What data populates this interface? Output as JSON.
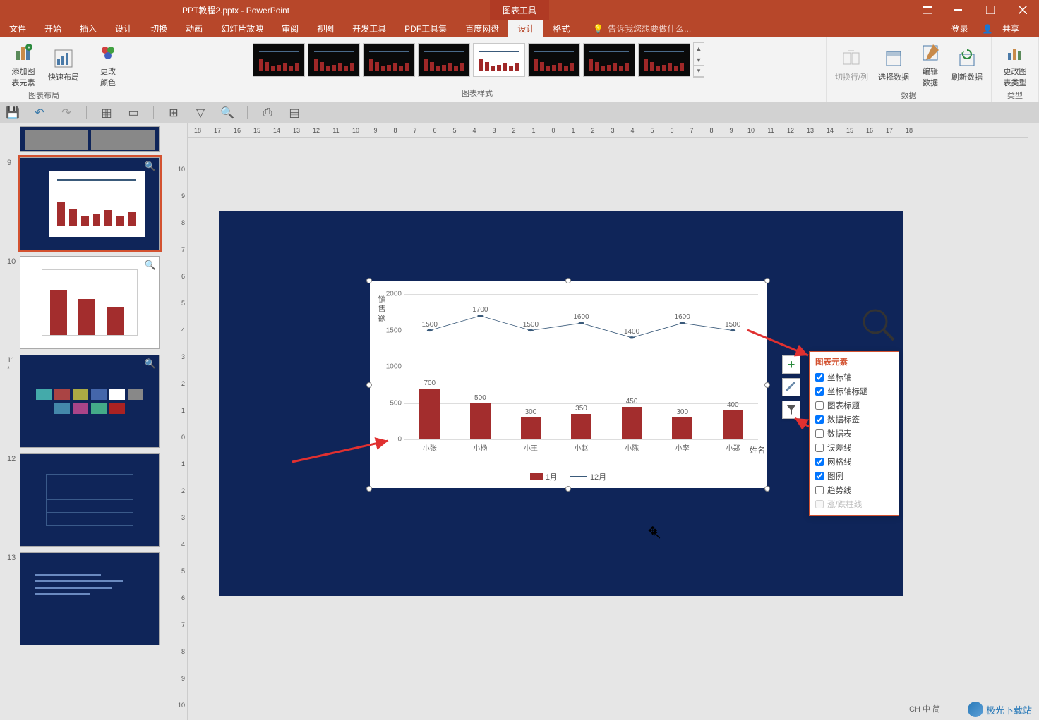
{
  "window": {
    "title": "PPT教程2.pptx - PowerPoint",
    "tools_tab": "图表工具",
    "login": "登录",
    "share": "共享"
  },
  "menu": {
    "tabs": [
      "文件",
      "开始",
      "插入",
      "设计",
      "切换",
      "动画",
      "幻灯片放映",
      "审阅",
      "视图",
      "开发工具",
      "PDF工具集",
      "百度网盘",
      "设计",
      "格式"
    ],
    "active_index": 12,
    "tell_me": "告诉我您想要做什么..."
  },
  "ribbon": {
    "group_layout": "图表布局",
    "btn_add_element": "添加图表元素",
    "btn_quick_layout": "快速布局",
    "btn_change_color": "更改颜色",
    "group_styles": "图表样式",
    "group_data": "数据",
    "btn_switch": "切换行/列",
    "btn_select_data": "选择数据",
    "btn_edit_data": "编辑数据",
    "btn_refresh": "刷新数据",
    "group_type": "类型",
    "btn_change_type": "更改图表类型"
  },
  "ruler_h": [
    "18",
    "17",
    "16",
    "15",
    "14",
    "13",
    "12",
    "11",
    "10",
    "9",
    "8",
    "7",
    "6",
    "5",
    "4",
    "3",
    "2",
    "1",
    "0",
    "1",
    "2",
    "3",
    "4",
    "5",
    "6",
    "7",
    "8",
    "9",
    "10",
    "11",
    "12",
    "13",
    "14",
    "15",
    "16",
    "17",
    "18"
  ],
  "ruler_v": [
    "10",
    "9",
    "8",
    "7",
    "6",
    "5",
    "4",
    "3",
    "2",
    "1",
    "0",
    "1",
    "2",
    "3",
    "4",
    "5",
    "6",
    "7",
    "8",
    "9",
    "10"
  ],
  "thumbs": [
    {
      "num": "9",
      "selected": true,
      "type": "chart"
    },
    {
      "num": "10",
      "type": "chart-simple"
    },
    {
      "num": "11",
      "star": "*",
      "type": "images"
    },
    {
      "num": "12",
      "type": "table"
    },
    {
      "num": "13",
      "type": "text"
    }
  ],
  "chart_data": {
    "type": "bar+line",
    "categories": [
      "小张",
      "小杨",
      "小王",
      "小赵",
      "小陈",
      "小李",
      "小郑"
    ],
    "series": [
      {
        "name": "1月",
        "type": "bar",
        "color": "#a32d2d",
        "values": [
          700,
          500,
          300,
          350,
          450,
          300,
          400
        ]
      },
      {
        "name": "12月",
        "type": "line",
        "color": "#3a5a7a",
        "values": [
          1500,
          1700,
          1500,
          1600,
          1400,
          1600,
          1500
        ]
      }
    ],
    "ylabel": "销售额",
    "xlabel": "姓名",
    "ylim": [
      0,
      2000
    ],
    "yticks": [
      0,
      500,
      1000,
      1500,
      2000
    ]
  },
  "chart_elements": {
    "title": "图表元素",
    "items": [
      {
        "label": "坐标轴",
        "checked": true
      },
      {
        "label": "坐标轴标题",
        "checked": true
      },
      {
        "label": "图表标题",
        "checked": false
      },
      {
        "label": "数据标签",
        "checked": true
      },
      {
        "label": "数据表",
        "checked": false
      },
      {
        "label": "误差线",
        "checked": false
      },
      {
        "label": "网格线",
        "checked": true
      },
      {
        "label": "图例",
        "checked": true
      },
      {
        "label": "趋势线",
        "checked": false
      },
      {
        "label": "涨/跌柱线",
        "checked": false,
        "disabled": true
      }
    ]
  },
  "status": {
    "ime": "CH 中 简",
    "watermark": "极光下载站"
  }
}
